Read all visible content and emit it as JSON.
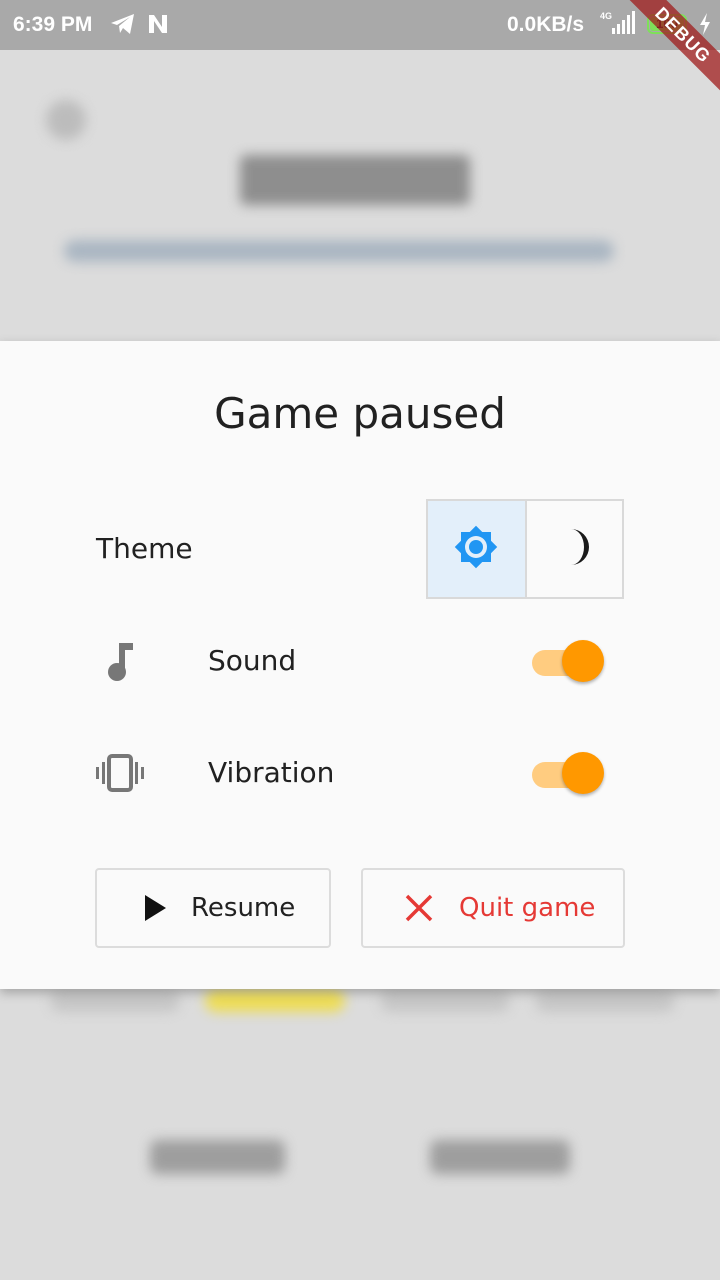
{
  "status_bar": {
    "time": "6:39 PM",
    "network_speed": "0.0KB/s",
    "network_type": "4G",
    "battery_level": "100",
    "icons": [
      "telegram-icon",
      "n-app-icon",
      "signal-icon",
      "battery-icon",
      "charging-icon"
    ]
  },
  "debug_banner": {
    "label": "DEBUG",
    "color": "#a01e1e"
  },
  "dialog": {
    "title": "Game paused",
    "theme": {
      "label": "Theme",
      "options": [
        {
          "icon": "light-theme-icon",
          "selected": true
        },
        {
          "icon": "dark-theme-moon-icon",
          "selected": false
        }
      ]
    },
    "sound": {
      "label": "Sound",
      "icon": "music-note-icon",
      "enabled": true
    },
    "vibration": {
      "label": "Vibration",
      "icon": "vibration-icon",
      "enabled": true
    },
    "resume_button": {
      "label": "Resume",
      "icon": "play-icon"
    },
    "quit_button": {
      "label": "Quit game",
      "icon": "close-icon",
      "color": "#e53935"
    }
  },
  "colors": {
    "accent": "#ff9800",
    "accent_light": "#ffcc80",
    "selected_theme_bg": "#e3effa",
    "light_icon": "#2196f3",
    "quit": "#e53935"
  }
}
